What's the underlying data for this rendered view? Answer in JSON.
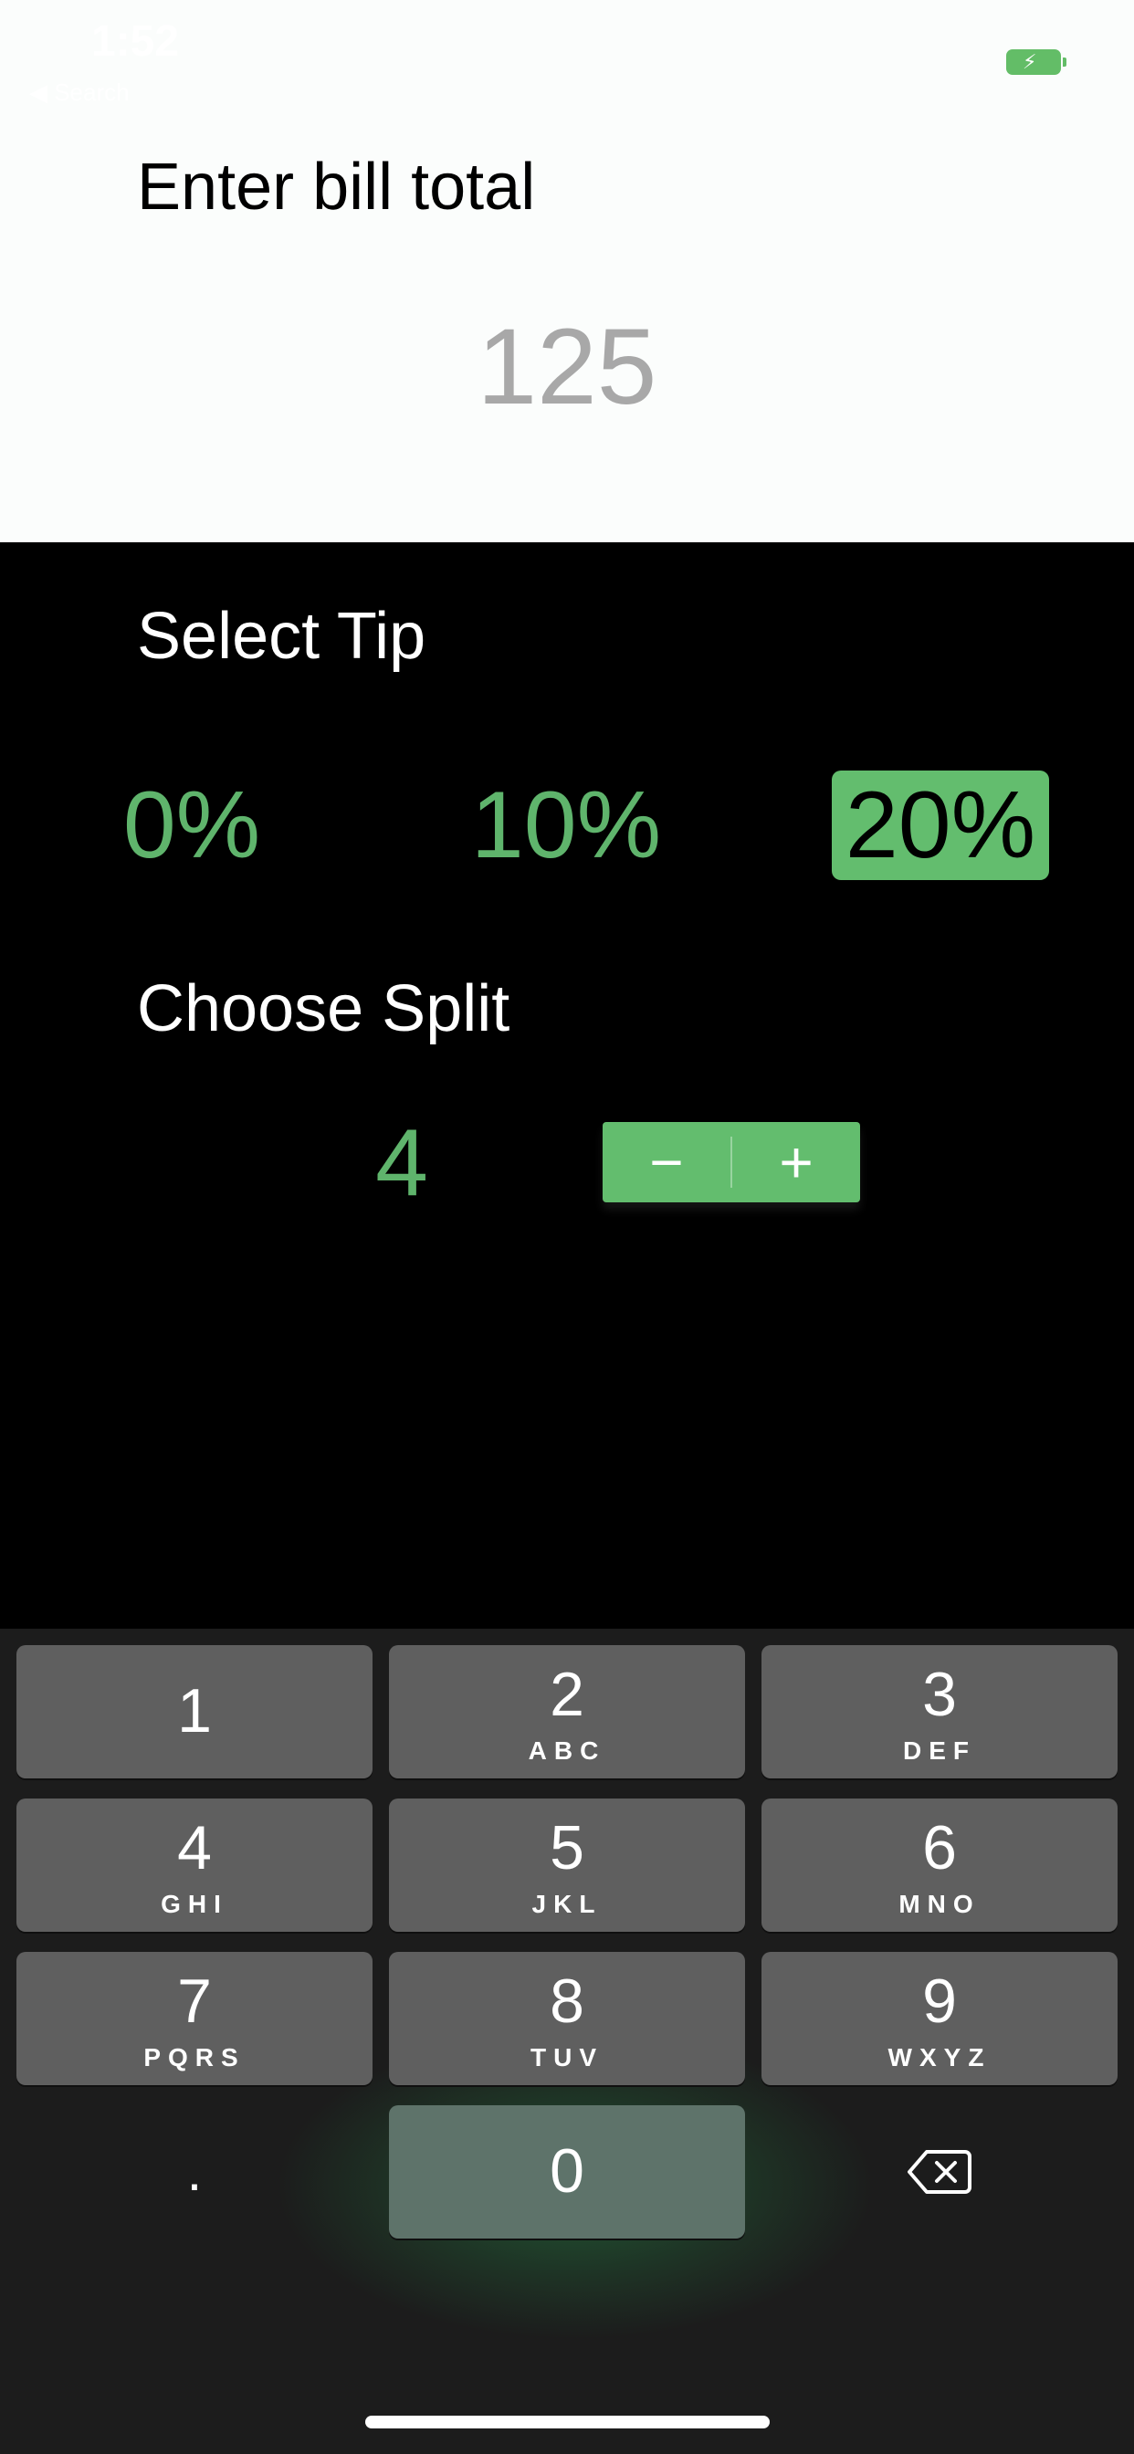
{
  "status_bar": {
    "time": "1:52",
    "carrier": "◀ Search"
  },
  "bill": {
    "label": "Enter bill total",
    "value": "125"
  },
  "tip": {
    "label": "Select Tip",
    "options": [
      "0%",
      "10%",
      "20%"
    ],
    "selected": "20%"
  },
  "split": {
    "label": "Choose Split",
    "value": "4",
    "minus": "−",
    "plus": "+"
  },
  "keyboard": {
    "keys": [
      {
        "digit": "1",
        "letters": ""
      },
      {
        "digit": "2",
        "letters": "ABC"
      },
      {
        "digit": "3",
        "letters": "DEF"
      },
      {
        "digit": "4",
        "letters": "GHI"
      },
      {
        "digit": "5",
        "letters": "JKL"
      },
      {
        "digit": "6",
        "letters": "MNO"
      },
      {
        "digit": "7",
        "letters": "PQRS"
      },
      {
        "digit": "8",
        "letters": "TUV"
      },
      {
        "digit": "9",
        "letters": "WXYZ"
      },
      {
        "digit": "0",
        "letters": ""
      }
    ],
    "decimal": ".",
    "delete_icon": "delete-left-icon"
  },
  "colors": {
    "accent_green": "#63bd6e",
    "text_green": "#5fb46c",
    "key_bg": "#5f5f5f",
    "keyboard_bg": "#1c1c1c"
  }
}
